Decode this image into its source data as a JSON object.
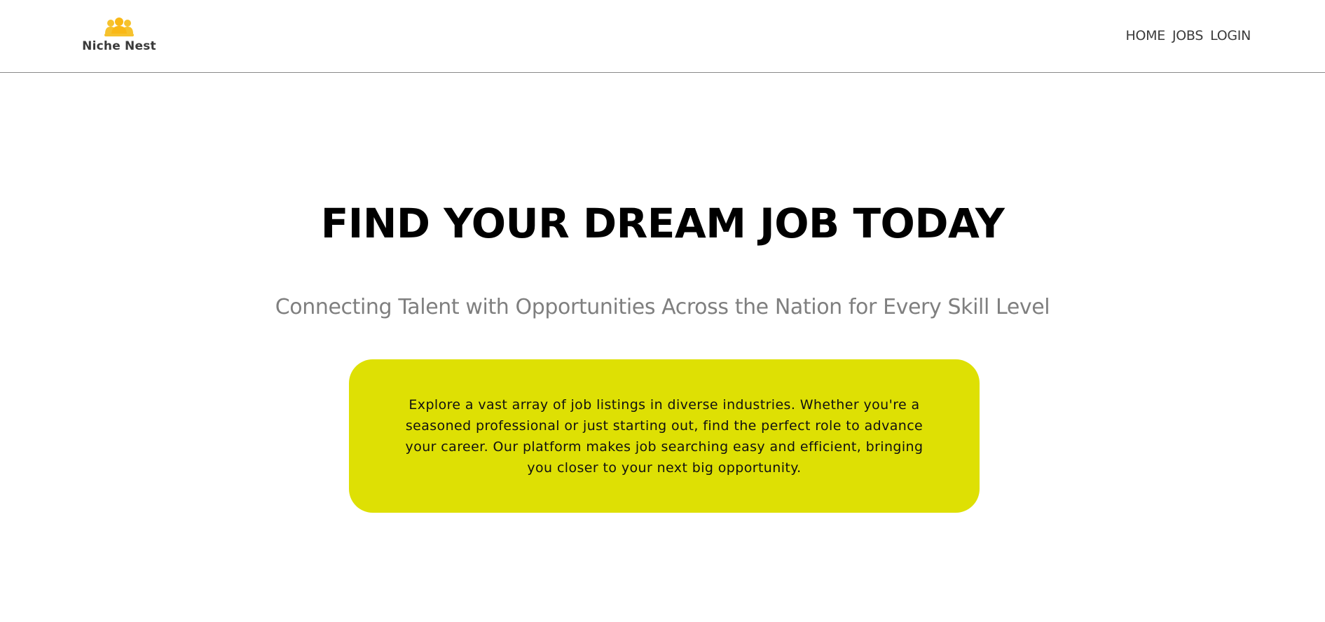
{
  "brand": {
    "name": "Niche Nest",
    "icon": "people-group-icon",
    "icon_color": "#f6c22d"
  },
  "nav": {
    "items": [
      {
        "label": "HOME"
      },
      {
        "label": "JOBS"
      },
      {
        "label": "LOGIN"
      }
    ]
  },
  "hero": {
    "title": "FIND YOUR DREAM JOB TODAY",
    "subtitle": "Connecting Talent with Opportunities Across the Nation for Every Skill Level"
  },
  "info_card": {
    "text": "Explore a vast array of job listings in diverse industries. Whether you're a seasoned professional or just starting out, find the perfect role to advance your career. Our platform makes job searching easy and efficient, bringing you closer to your next big opportunity.",
    "background_color": "#dee004"
  },
  "colors": {
    "accent": "#dee004",
    "heading": "#000000",
    "subtitle": "#7f7f7f",
    "nav_text": "#3b3b3b"
  }
}
